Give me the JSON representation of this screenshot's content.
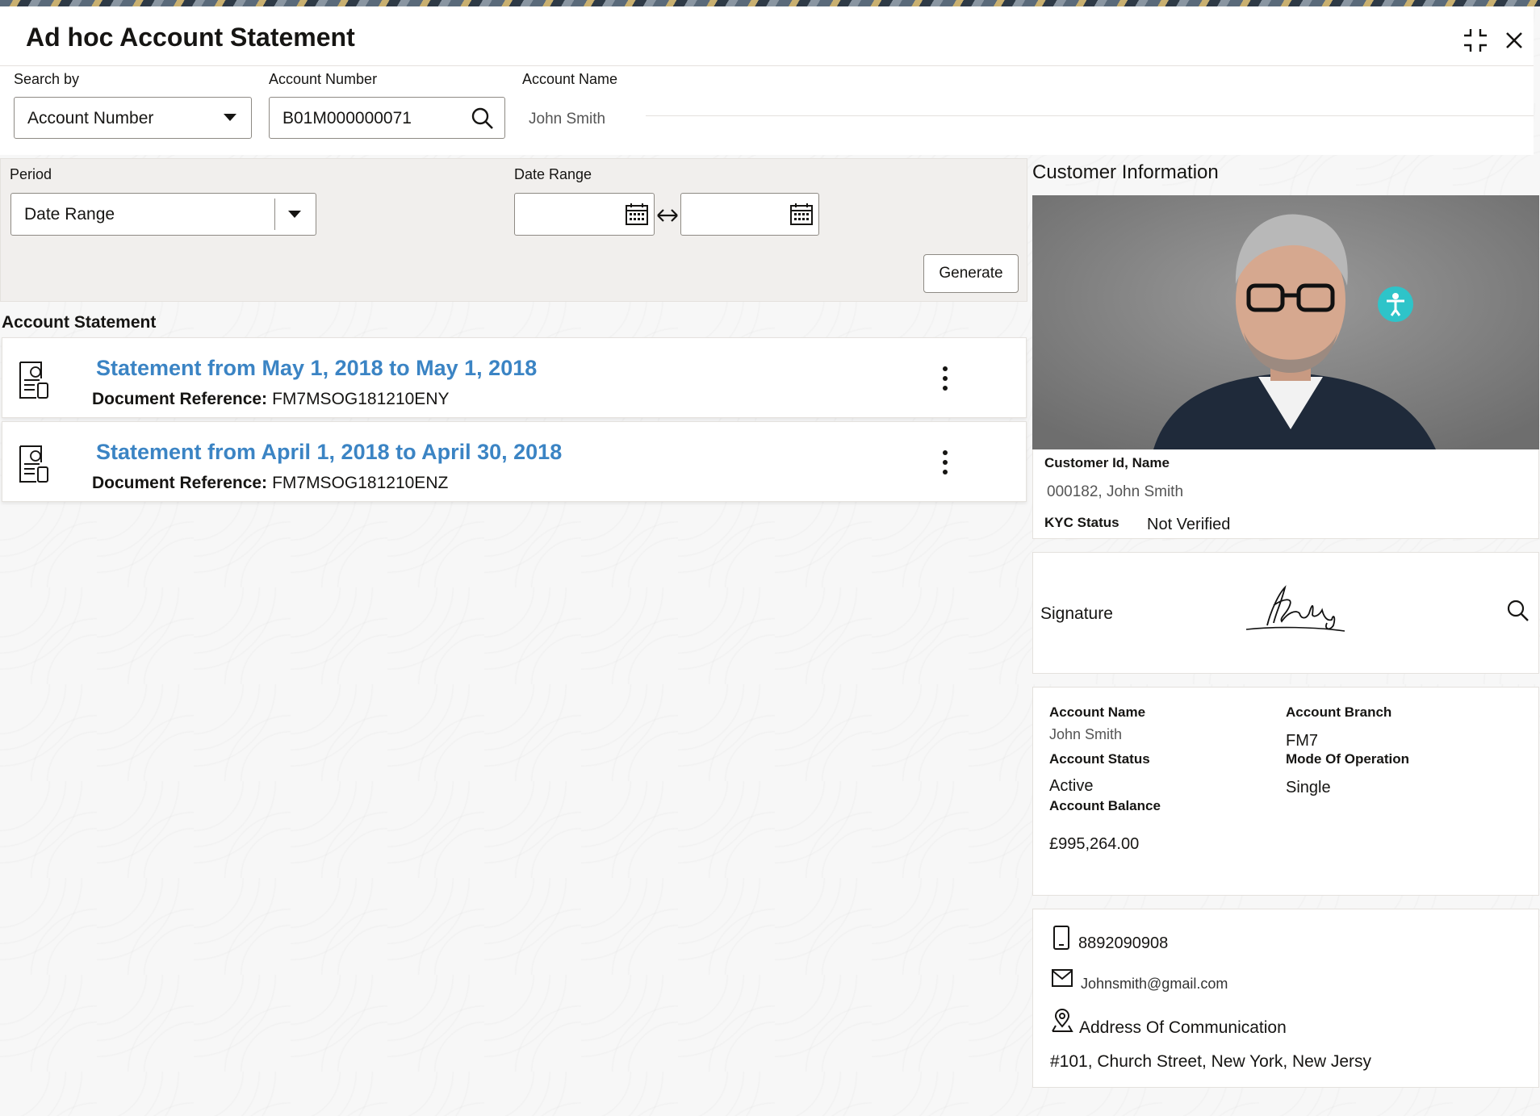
{
  "window": {
    "title": "Ad hoc Account Statement",
    "minimize_icon": "collapse-icon",
    "close_icon": "close-icon"
  },
  "search": {
    "search_by_label": "Search by",
    "search_by_value": "Account Number",
    "account_number_label": "Account Number",
    "account_number_value": "B01M000000071",
    "account_name_label": "Account Name",
    "account_name_value": "John Smith"
  },
  "filter": {
    "period_label": "Period",
    "period_value": "Date Range",
    "date_range_label": "Date Range",
    "from_date": "",
    "to_date": "",
    "generate_label": "Generate"
  },
  "statements": {
    "section_title": "Account Statement",
    "doc_ref_label": "Document Reference:",
    "items": [
      {
        "title": "Statement from May 1, 2018 to May 1, 2018",
        "doc_ref": "FM7MSOG181210ENY"
      },
      {
        "title": "Statement from April 1, 2018 to April 30, 2018",
        "doc_ref": "FM7MSOG181210ENZ"
      }
    ]
  },
  "customer": {
    "section_title": "Customer Information",
    "id_name_label": "Customer Id, Name",
    "id_name_value": "000182, John Smith",
    "kyc_label": "KYC Status",
    "kyc_value": "Not Verified",
    "signature_label": "Signature"
  },
  "account": {
    "name_label": "Account Name",
    "name_value": "John Smith",
    "branch_label": "Account Branch",
    "branch_value": "FM7",
    "status_label": "Account Status",
    "status_value": "Active",
    "mode_label": "Mode Of Operation",
    "mode_value": "Single",
    "balance_label": "Account Balance",
    "balance_value": "£995,264.00"
  },
  "contact": {
    "phone": "8892090908",
    "email": "Johnsmith@gmail.com",
    "address_label": "Address Of Communication",
    "address_value": "#101, Church Street, New York, New Jersy"
  },
  "colors": {
    "link": "#3b84c4",
    "accent_teal": "#2ec4c9"
  }
}
